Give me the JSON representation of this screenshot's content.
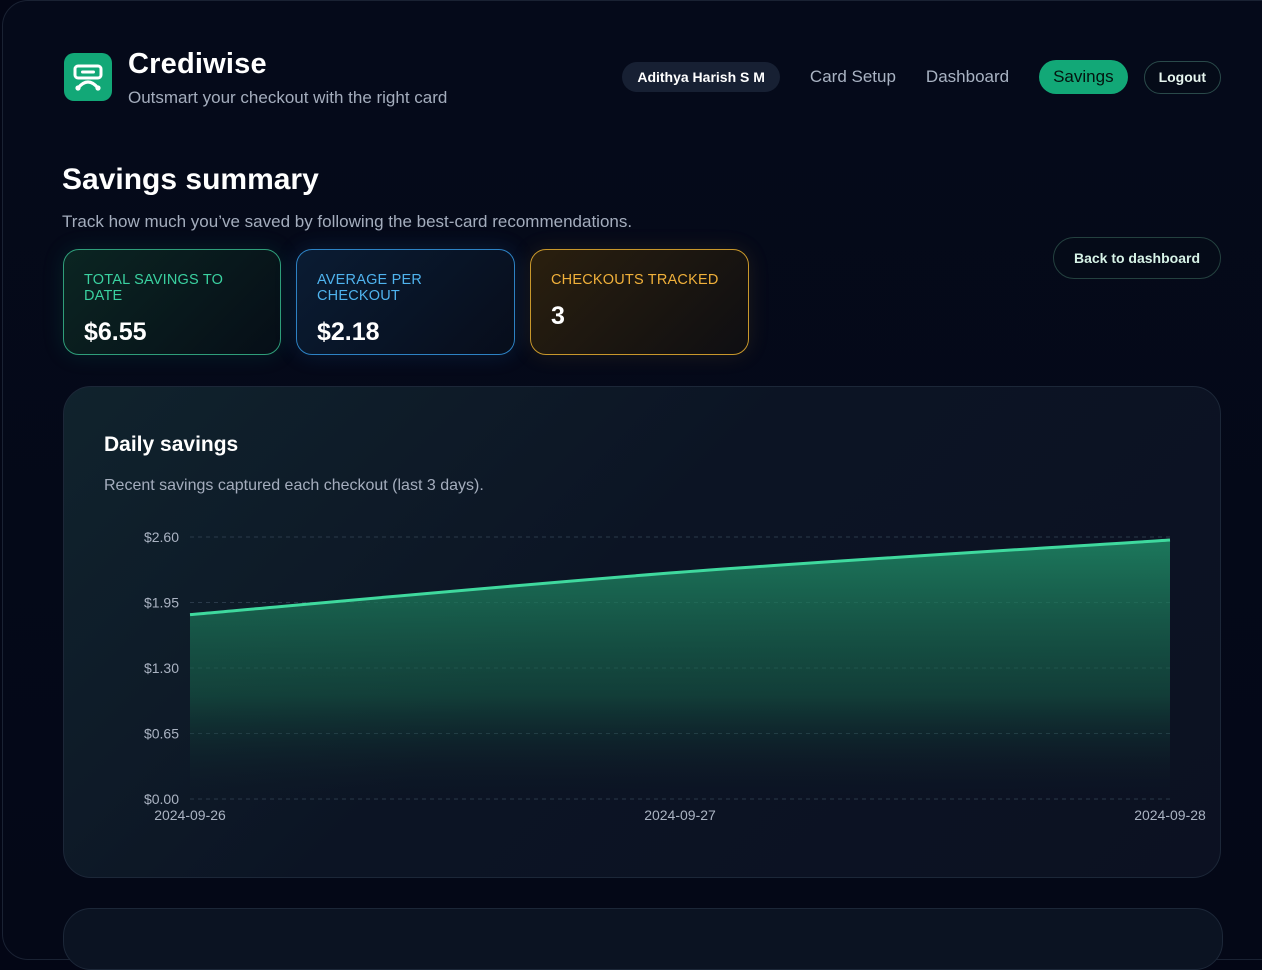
{
  "header": {
    "brand_name": "Crediwise",
    "tagline": "Outsmart your checkout with the right card",
    "user_name": "Adithya Harish S M",
    "nav_items": [
      "Card Setup",
      "Dashboard",
      "Savings"
    ],
    "active_nav": "Savings",
    "logout_label": "Logout",
    "logo_icon": "credit-card-icon"
  },
  "summary": {
    "title": "Savings summary",
    "subtitle": "Track how much you’ve saved by following the best-card recommendations.",
    "back_label": "Back to dashboard",
    "stats": [
      {
        "label": "TOTAL SAVINGS TO DATE",
        "value": "$6.55",
        "color": "#3ad1a0"
      },
      {
        "label": "AVERAGE PER CHECKOUT",
        "value": "$2.18",
        "color": "#4fb3ee"
      },
      {
        "label": "CHECKOUTS TRACKED",
        "value": "3",
        "color": "#f0b03a"
      }
    ]
  },
  "chart": {
    "title": "Daily savings",
    "subtitle": "Recent savings captured each checkout (last 3 days)."
  },
  "chart_data": {
    "type": "area",
    "title": "Daily savings",
    "x": [
      "2024-09-26",
      "2024-09-27",
      "2024-09-28"
    ],
    "series": [
      {
        "values": [
          1.83,
          2.25,
          2.57
        ]
      }
    ],
    "y_ticks": [
      "$2.60",
      "$1.95",
      "$1.30",
      "$0.65",
      "$0.00"
    ],
    "y_tick_values": [
      2.6,
      1.95,
      1.3,
      0.65,
      0
    ],
    "ylim": [
      0,
      2.6
    ],
    "grid": true,
    "line_color": "#3fd99e",
    "fill_color": "#1f8a66"
  }
}
